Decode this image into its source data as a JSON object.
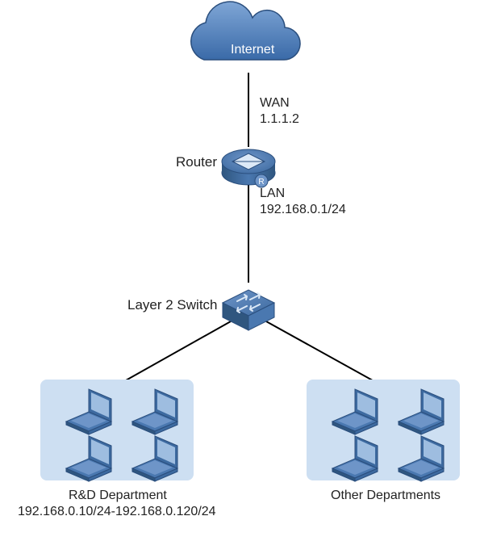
{
  "cloud": {
    "label": "Internet"
  },
  "router": {
    "wan_label": "WAN",
    "wan_ip": "1.1.1.2",
    "name": "Router",
    "lan_label": "LAN",
    "lan_subnet": "192.168.0.1/24"
  },
  "switch": {
    "label": "Layer 2 Switch"
  },
  "groups": {
    "rd": {
      "title": "R&D Department",
      "range": "192.168.0.10/24-192.168.0.120/24"
    },
    "other": {
      "title": "Other Departments"
    }
  },
  "colors": {
    "blue_dark": "#3a6aa8",
    "blue_mid": "#5784c4",
    "blue_light": "#cddff2",
    "outline": "#2a4e7d"
  }
}
